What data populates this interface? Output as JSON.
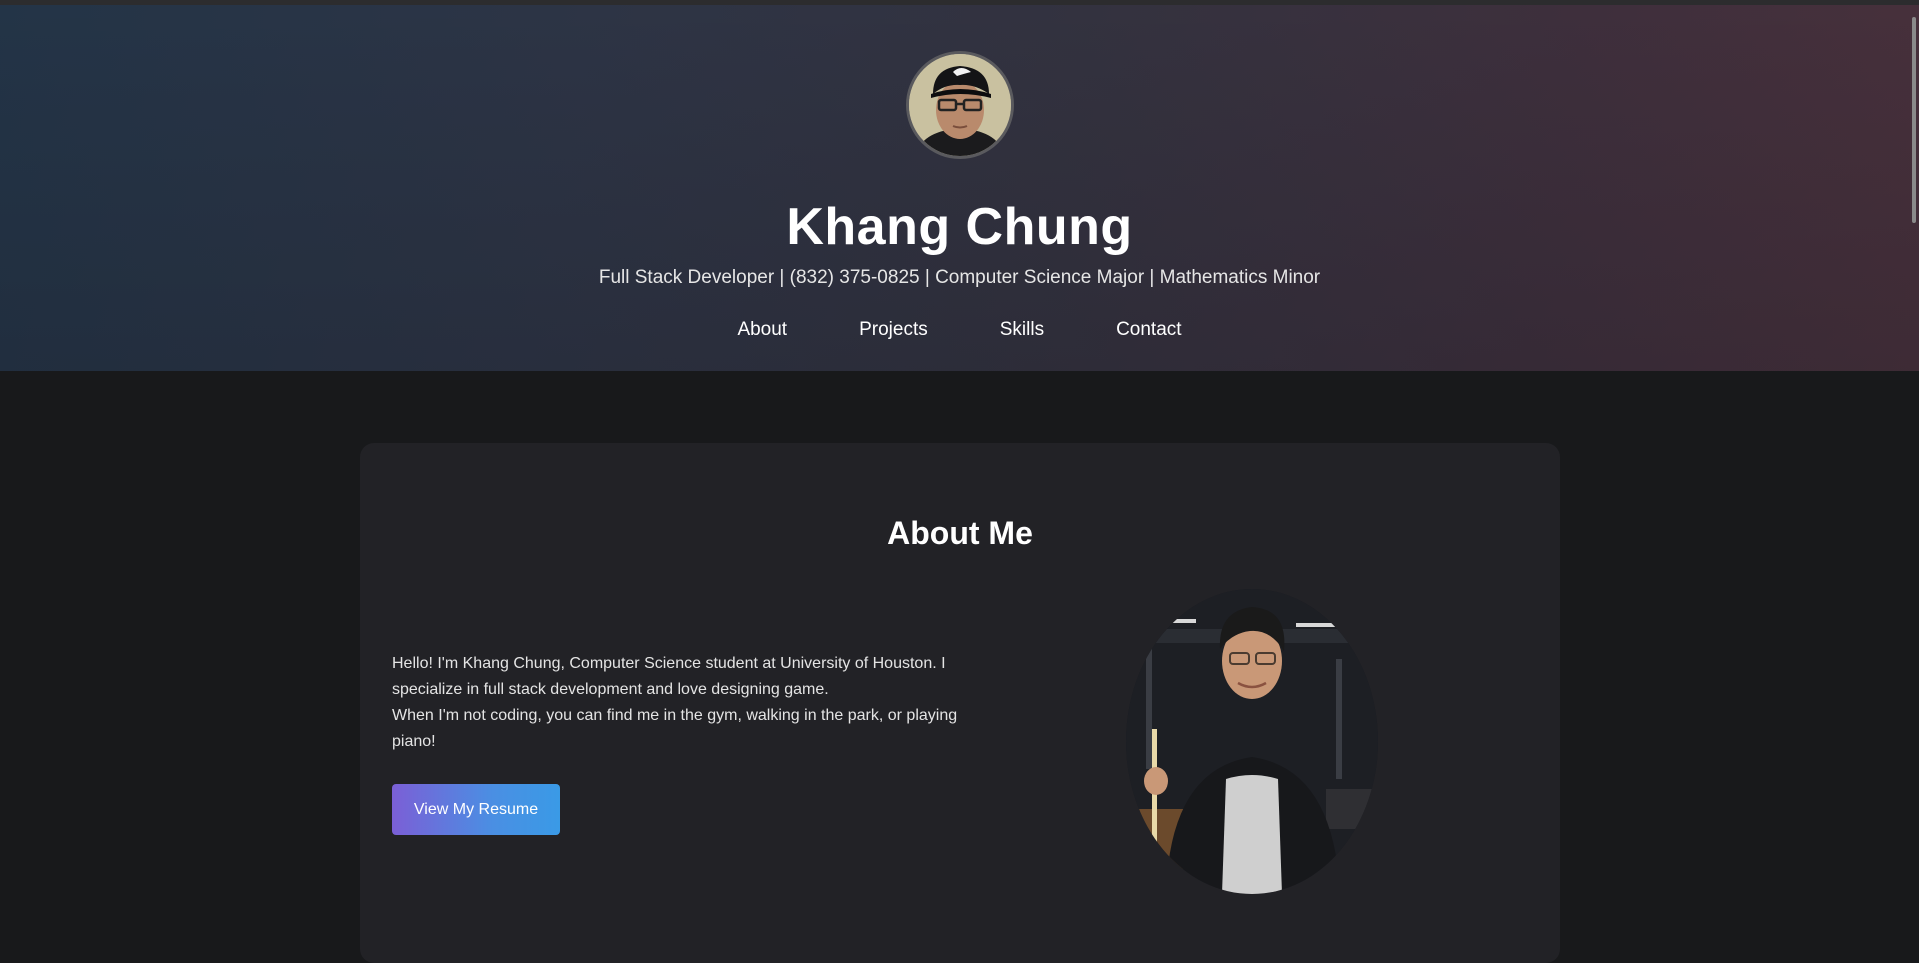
{
  "header": {
    "name": "Khang Chung",
    "subtitle": "Full Stack Developer | (832) 375-0825 | Computer Science Major | Mathematics Minor",
    "nav": [
      {
        "label": "About"
      },
      {
        "label": "Projects"
      },
      {
        "label": "Skills"
      },
      {
        "label": "Contact"
      }
    ]
  },
  "about": {
    "title": "About Me",
    "paragraph1": "Hello! I'm Khang Chung, Computer Science student at University of Houston. I specialize in full stack development and love designing game.",
    "paragraph2": "When I'm not coding, you can find me in the gym, walking in the park, or playing piano!",
    "resume_button": "View My Resume"
  },
  "colors": {
    "page_bg": "#18191b",
    "card_bg": "#222226",
    "button_gradient_start": "#7b5fd6",
    "button_gradient_end": "#3a9ae6"
  },
  "icons": {
    "profile_avatar": "profile-photo",
    "about_photo": "portrait-photo"
  }
}
